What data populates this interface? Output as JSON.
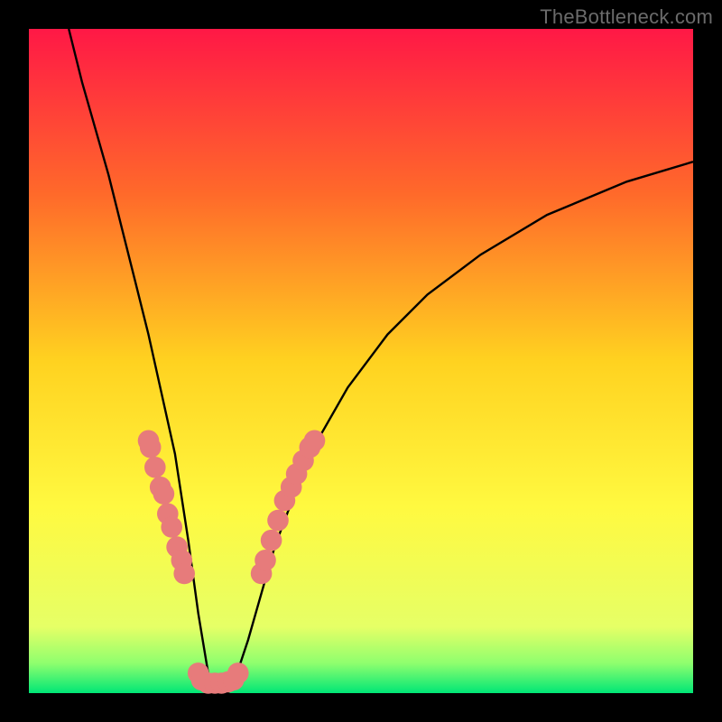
{
  "watermark": "TheBottleneck.com",
  "chart_data": {
    "type": "line",
    "title": "",
    "xlabel": "",
    "ylabel": "",
    "xlim": [
      0,
      100
    ],
    "ylim": [
      0,
      100
    ],
    "grid": false,
    "legend": false,
    "gradient_stops": [
      {
        "offset": 0.0,
        "color": "#ff1846"
      },
      {
        "offset": 0.25,
        "color": "#ff6a2a"
      },
      {
        "offset": 0.5,
        "color": "#ffd220"
      },
      {
        "offset": 0.72,
        "color": "#fff940"
      },
      {
        "offset": 0.9,
        "color": "#e6ff66"
      },
      {
        "offset": 0.955,
        "color": "#8fff6e"
      },
      {
        "offset": 1.0,
        "color": "#00e676"
      }
    ],
    "series": [
      {
        "name": "curve",
        "color": "#000000",
        "x": [
          6,
          8,
          10,
          12,
          14,
          16,
          18,
          20,
          22,
          24,
          25.5,
          27,
          28,
          29,
          30,
          31,
          33,
          35,
          37,
          40,
          44,
          48,
          54,
          60,
          68,
          78,
          90,
          100
        ],
        "y": [
          100,
          92,
          85,
          78,
          70,
          62,
          54,
          45,
          36,
          23,
          12,
          3,
          0,
          0,
          0,
          2,
          8,
          15,
          22,
          30,
          39,
          46,
          54,
          60,
          66,
          72,
          77,
          80
        ]
      }
    ],
    "markers": {
      "color": "#e77b7b",
      "radius": 1.6,
      "points": [
        {
          "x": 18.0,
          "y": 38
        },
        {
          "x": 18.3,
          "y": 37
        },
        {
          "x": 19.0,
          "y": 34
        },
        {
          "x": 19.8,
          "y": 31
        },
        {
          "x": 20.3,
          "y": 30
        },
        {
          "x": 20.9,
          "y": 27
        },
        {
          "x": 21.5,
          "y": 25
        },
        {
          "x": 22.3,
          "y": 22
        },
        {
          "x": 23.0,
          "y": 20
        },
        {
          "x": 23.4,
          "y": 18
        },
        {
          "x": 25.5,
          "y": 3
        },
        {
          "x": 26.0,
          "y": 2
        },
        {
          "x": 27.0,
          "y": 1.5
        },
        {
          "x": 28.0,
          "y": 1.5
        },
        {
          "x": 29.0,
          "y": 1.5
        },
        {
          "x": 30.0,
          "y": 1.7
        },
        {
          "x": 30.8,
          "y": 2
        },
        {
          "x": 31.5,
          "y": 3
        },
        {
          "x": 35.0,
          "y": 18
        },
        {
          "x": 35.6,
          "y": 20
        },
        {
          "x": 36.5,
          "y": 23
        },
        {
          "x": 37.5,
          "y": 26
        },
        {
          "x": 38.5,
          "y": 29
        },
        {
          "x": 39.5,
          "y": 31
        },
        {
          "x": 40.3,
          "y": 33
        },
        {
          "x": 41.3,
          "y": 35
        },
        {
          "x": 42.3,
          "y": 37
        },
        {
          "x": 43.0,
          "y": 38
        }
      ]
    }
  }
}
